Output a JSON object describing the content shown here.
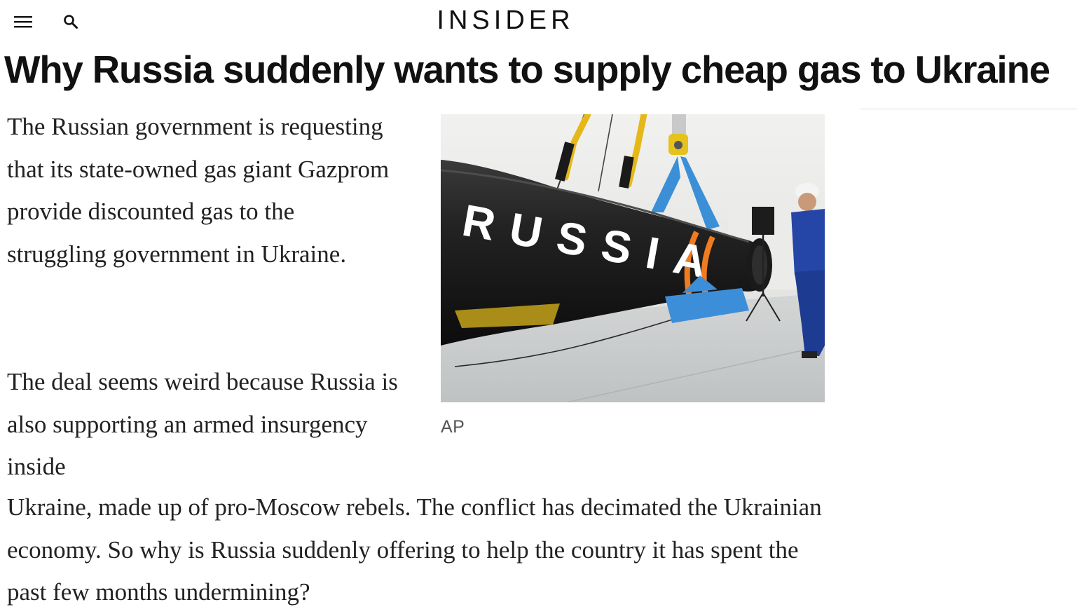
{
  "header": {
    "menu_icon": "hamburger-menu-icon",
    "search_icon": "search-icon",
    "logo_text": "INSIDER"
  },
  "article": {
    "headline": "Why Russia suddenly wants to supply cheap gas to Ukraine",
    "paragraph_1": "The Russian government is requesting that its state-owned gas giant Gazprom provide discounted gas to the struggling government in Ukraine.",
    "paragraph_2_part_1": "The deal seems weird because Russia is also supporting an armed insurgency inside",
    "paragraph_2_part_2": "Ukraine, made up of pro-Moscow rebels. The conflict has decimated the Ukrainian economy. So why is Russia suddenly offering to help the country it has spent the past few months undermining?",
    "image": {
      "pipe_text": "RUSSIA",
      "credit": "AP"
    }
  },
  "colors": {
    "text": "#222222",
    "headline": "#111111",
    "credit": "#555555",
    "divider": "#dddddd"
  }
}
